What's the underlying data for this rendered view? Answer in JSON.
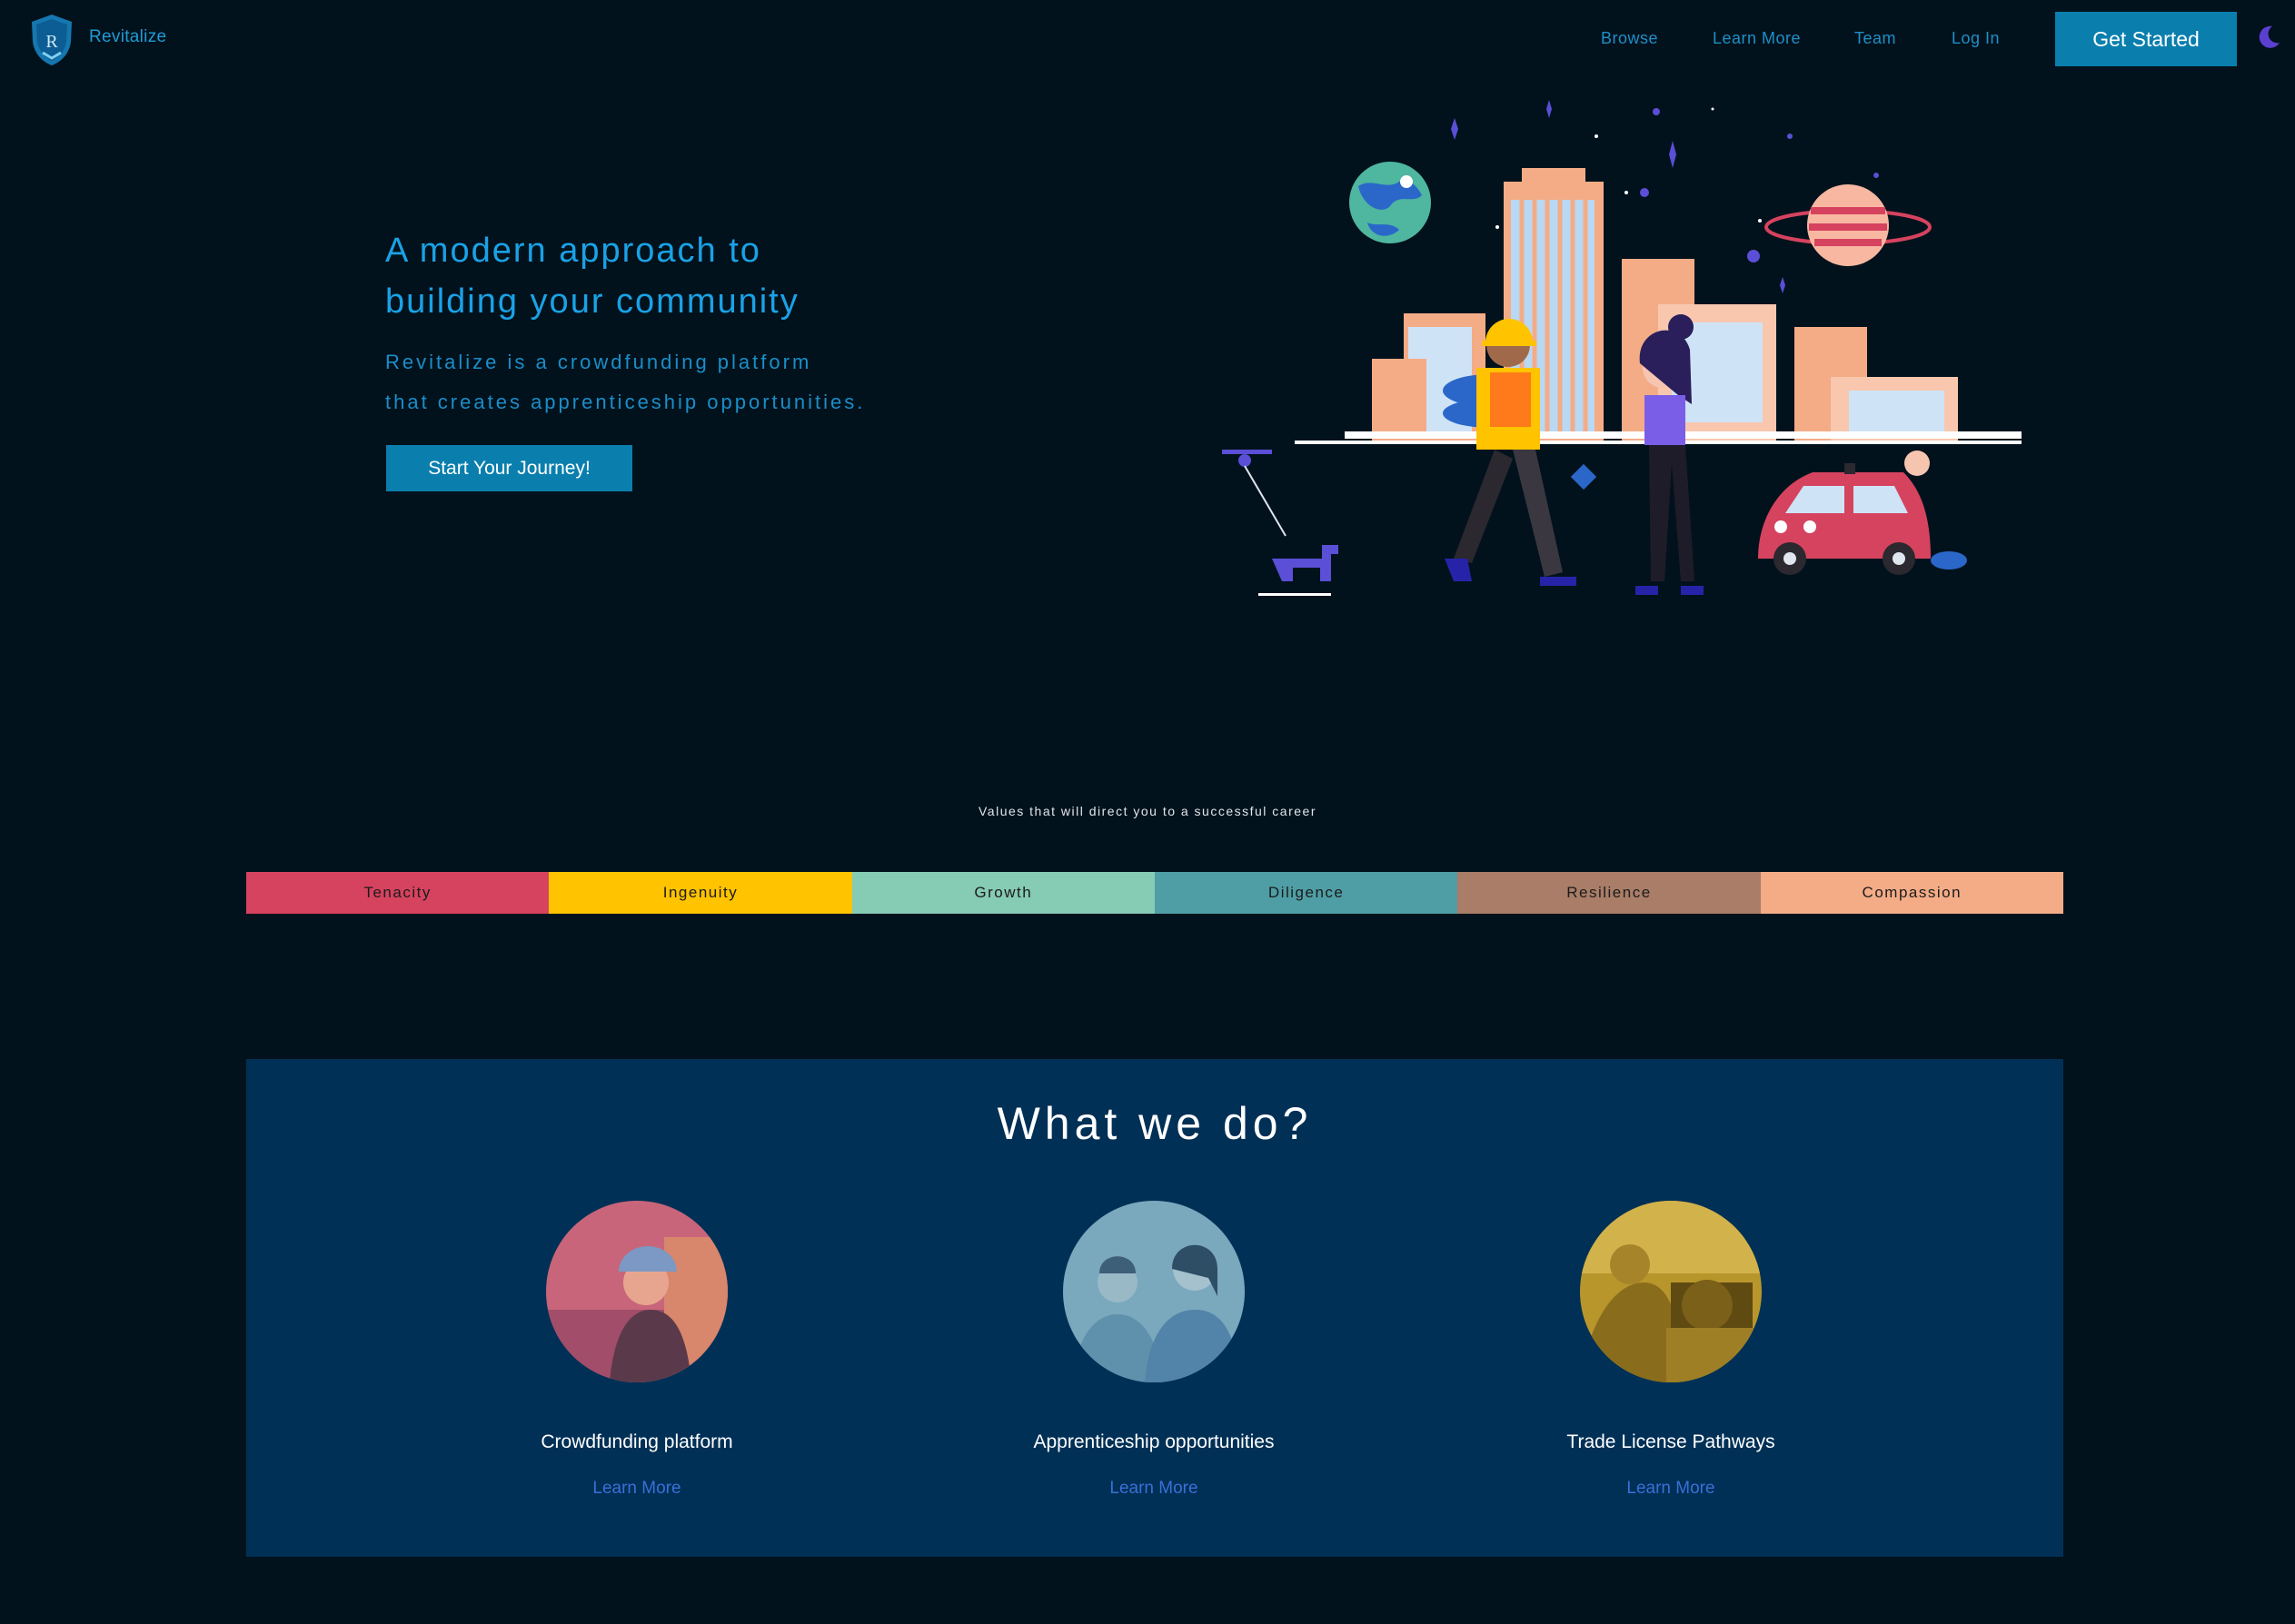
{
  "nav": {
    "brand": "Revitalize",
    "logo_letter": "R",
    "links": [
      "Browse",
      "Learn More",
      "Team",
      "Log In"
    ],
    "cta": "Get Started",
    "theme_toggle_icon": "moon-icon"
  },
  "hero": {
    "title_line1": "A modern approach to",
    "title_line2": "building your community",
    "sub_line1": "Revitalize is a crowdfunding platform",
    "sub_line2": "that creates apprenticeship opportunities.",
    "button": "Start Your Journey!"
  },
  "values": {
    "caption": "Values that will direct you to a successful career",
    "items": [
      {
        "label": "Tenacity",
        "color": "#d6435f"
      },
      {
        "label": "Ingenuity",
        "color": "#ffc300"
      },
      {
        "label": "Growth",
        "color": "#86cbb4"
      },
      {
        "label": "Diligence",
        "color": "#4f9ea5"
      },
      {
        "label": "Resilience",
        "color": "#a97d67"
      },
      {
        "label": "Compassion",
        "color": "#f4ac87"
      }
    ]
  },
  "what_we_do": {
    "title": "What we do?",
    "cards": [
      {
        "title": "Crowdfunding platform",
        "link": "Learn More"
      },
      {
        "title": "Apprenticeship opportunities",
        "link": "Learn More"
      },
      {
        "title": "Trade License Pathways",
        "link": "Learn More"
      }
    ]
  },
  "colors": {
    "background": "#02121c",
    "accent": "#0a7fae",
    "section_bg": "#003056",
    "link": "#3a6fd8"
  }
}
